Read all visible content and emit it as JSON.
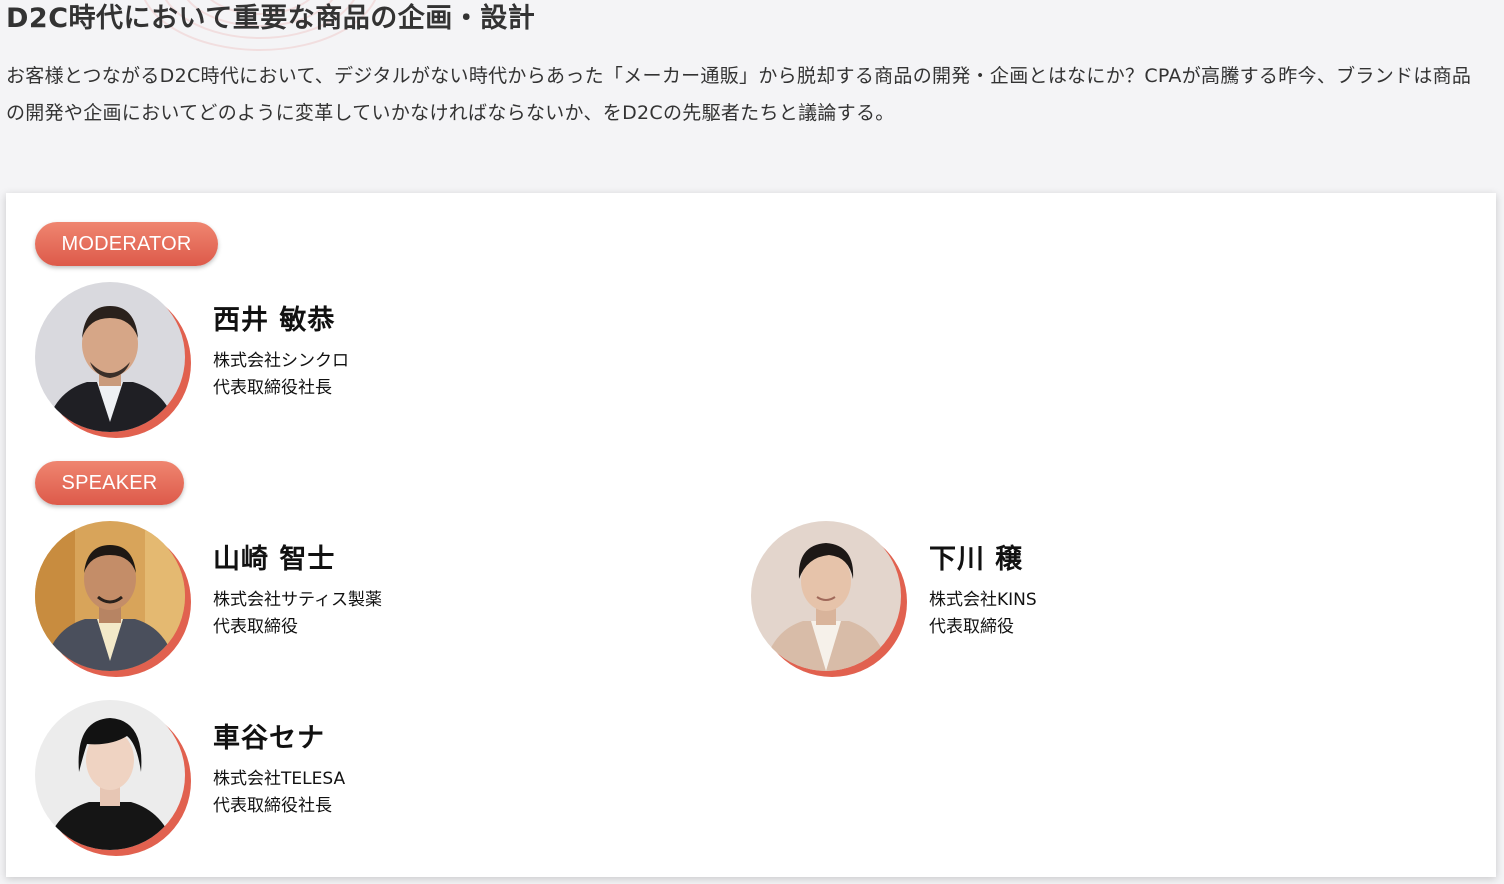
{
  "session": {
    "title": "D2C時代において重要な商品の企画・設計",
    "description": "お客様とつながるD2C時代において、デジタルがない時代からあった「メーカー通販」から脱却する商品の開発・企画とはなにか？CPAが高騰する昨今、ブランドは商品の開発や企画においてどのように変革していかなければならないか、をD2Cの先駆者たちと議論する。"
  },
  "moderator": {
    "label": "MODERATOR",
    "people": [
      {
        "name": "西井 敏恭",
        "company": "株式会社シンクロ",
        "title": "代表取締役社長"
      }
    ]
  },
  "speaker": {
    "label": "SPEAKER",
    "people": [
      {
        "name": "山崎 智士",
        "company": "株式会社サティス製薬",
        "title": "代表取締役"
      },
      {
        "name": "下川 穣",
        "company": "株式会社KINS",
        "title": "代表取締役"
      },
      {
        "name": "車谷セナ",
        "company": "株式会社TELESA",
        "title": "代表取締役社長"
      }
    ]
  },
  "colors": {
    "accent": "#e1614f",
    "pill_gradient_top": "#ef8670",
    "pill_gradient_bottom": "#dd5a4a",
    "page_background": "#f4f4f6",
    "panel_background": "#ffffff"
  }
}
